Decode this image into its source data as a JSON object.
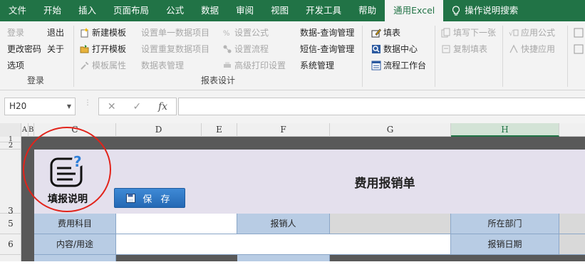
{
  "tabs": [
    "文件",
    "开始",
    "插入",
    "页面布局",
    "公式",
    "数据",
    "审阅",
    "视图",
    "开发工具",
    "帮助",
    "通用Excel"
  ],
  "search_label": "操作说明搜索",
  "ribbon": {
    "login": {
      "login": "登录",
      "logout": "退出",
      "change_pwd": "更改密码",
      "about": "关于",
      "options": "选项",
      "group_label": "登录"
    },
    "template": {
      "new": "新建模板",
      "open": "打开模板",
      "props": "模板属性"
    },
    "setup": {
      "single": "设置单一数据项目",
      "repeat": "设置重复数据项目",
      "table_mgmt": "数据表管理",
      "formula": "设置公式",
      "flow": "设置流程",
      "print": "高级打印设置",
      "group_label": "报表设计"
    },
    "query": {
      "data": "数据-查询管理",
      "sms": "短信-查询管理",
      "system": "系统管理"
    },
    "fill": {
      "fill": "填表",
      "center": "数据中心",
      "workbench": "流程工作台"
    },
    "next": {
      "fill_next": "填写下一张",
      "copy": "复制填表"
    },
    "apply": {
      "apply": "应用公式",
      "quick": "快捷应用"
    }
  },
  "formula_bar": {
    "name_box": "H20",
    "fx": "fx"
  },
  "columns": [
    "A",
    "B",
    "C",
    "D",
    "E",
    "F",
    "G",
    "H"
  ],
  "rows": [
    "1",
    "2",
    "3",
    "5",
    "6"
  ],
  "form": {
    "title": "费用报销单",
    "save_label": "保 存",
    "help_label": "填报说明",
    "fields": [
      "费用科目",
      "报销人",
      "所在部门",
      "内容/用途",
      "报销日期"
    ]
  },
  "colors": {
    "accent": "#217346",
    "annotation": "#e2231a",
    "label_bg": "#b8cce4"
  }
}
